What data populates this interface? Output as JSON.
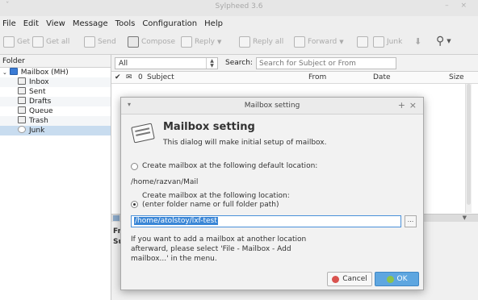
{
  "window": {
    "title": "Sylpheed 3.6",
    "left_controls": "ˇ",
    "right_controls": "– ×"
  },
  "menu": [
    "File",
    "Edit",
    "View",
    "Message",
    "Tools",
    "Configuration",
    "Help"
  ],
  "toolbar": {
    "get": "Get",
    "get_all": "Get all",
    "send": "Send",
    "compose": "Compose",
    "reply": "Reply",
    "reply_all": "Reply all",
    "forward": "Forward",
    "junk": "Junk",
    "search_icon": "search-icon"
  },
  "folders": {
    "header": "Folder",
    "mailbox": "Mailbox (MH)",
    "items": [
      "Inbox",
      "Sent",
      "Drafts",
      "Queue",
      "Trash",
      "Junk"
    ]
  },
  "filter": {
    "scope_value": "All",
    "search_label": "Search:",
    "search_placeholder": "Search for Subject or From"
  },
  "columns": {
    "check": "✔",
    "mail": "✉",
    "attach": "0",
    "subject": "Subject",
    "from": "From",
    "date": "Date",
    "size": "Size"
  },
  "preview": {
    "from_label": "Fr",
    "subject_label": "Su"
  },
  "dialog": {
    "window_title": "Mailbox setting",
    "heading": "Mailbox setting",
    "subtitle": "This dialog will make initial setup of mailbox.",
    "option_default_label": "Create mailbox at the following default location:",
    "default_path": "/home/razvan/Mail",
    "option_custom_line1": "Create mailbox at the following location:",
    "option_custom_line2": "(enter folder name or full folder path)",
    "custom_path_value": "/home/atolstoy/lxf-test",
    "browse_label": "...",
    "info_text": "If you want to add a mailbox at another location afterward, please select 'File - Mailbox - Add mailbox...' in the menu.",
    "cancel_label": "Cancel",
    "ok_label": "OK"
  }
}
